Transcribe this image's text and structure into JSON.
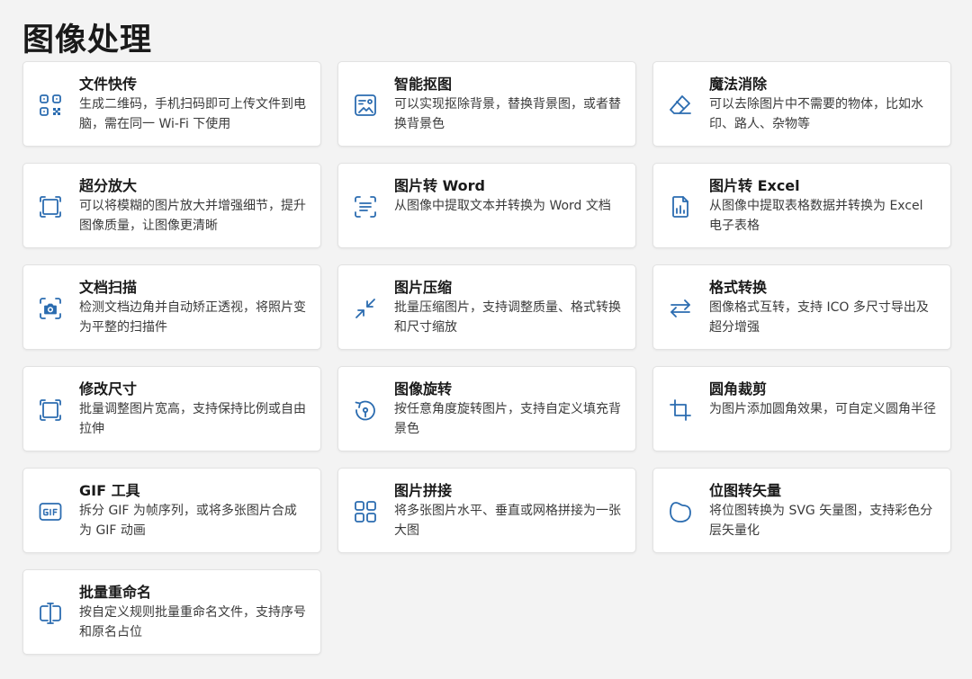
{
  "page": {
    "title": "图像处理"
  },
  "colors": {
    "accent": "#2b6cb0",
    "background": "#f3f3f3",
    "card": "#ffffff"
  },
  "tools": [
    {
      "title": "文件快传",
      "desc": "生成二维码，手机扫码即可上传文件到电脑，需在同一 Wi-Fi 下使用",
      "icon": "qr-code-icon"
    },
    {
      "title": "智能抠图",
      "desc": "可以实现抠除背景，替换背景图，或者替换背景色",
      "icon": "image-cutout-icon"
    },
    {
      "title": "魔法消除",
      "desc": "可以去除图片中不需要的物体，比如水印、路人、杂物等",
      "icon": "eraser-icon"
    },
    {
      "title": "超分放大",
      "desc": "可以将模糊的图片放大并增强细节，提升图像质量，让图像更清晰",
      "icon": "upscale-frame-icon"
    },
    {
      "title": "图片转 Word",
      "desc": "从图像中提取文本并转换为 Word 文档",
      "icon": "text-scan-icon"
    },
    {
      "title": "图片转 Excel",
      "desc": "从图像中提取表格数据并转换为 Excel 电子表格",
      "icon": "spreadsheet-icon"
    },
    {
      "title": "文档扫描",
      "desc": "检测文档边角并自动矫正透视，将照片变为平整的扫描件",
      "icon": "camera-scan-icon"
    },
    {
      "title": "图片压缩",
      "desc": "批量压缩图片，支持调整质量、格式转换和尺寸缩放",
      "icon": "compress-arrows-icon"
    },
    {
      "title": "格式转换",
      "desc": "图像格式互转，支持 ICO 多尺寸导出及超分增强",
      "icon": "swap-arrows-icon"
    },
    {
      "title": "修改尺寸",
      "desc": "批量调整图片宽高，支持保持比例或自由拉伸",
      "icon": "resize-frame-icon"
    },
    {
      "title": "图像旋转",
      "desc": "按任意角度旋转图片，支持自定义填充背景色",
      "icon": "rotate-icon"
    },
    {
      "title": "圆角裁剪",
      "desc": "为图片添加圆角效果，可自定义圆角半径",
      "icon": "crop-icon"
    },
    {
      "title": "GIF 工具",
      "desc": "拆分 GIF 为帧序列，或将多张图片合成为 GIF 动画",
      "icon": "gif-icon"
    },
    {
      "title": "图片拼接",
      "desc": "将多张图片水平、垂直或网格拼接为一张大图",
      "icon": "grid-tiles-icon"
    },
    {
      "title": "位图转矢量",
      "desc": "将位图转换为 SVG 矢量图，支持彩色分层矢量化",
      "icon": "vector-shape-icon"
    },
    {
      "title": "批量重命名",
      "desc": "按自定义规则批量重命名文件，支持序号和原名占位",
      "icon": "rename-cursor-icon"
    }
  ]
}
